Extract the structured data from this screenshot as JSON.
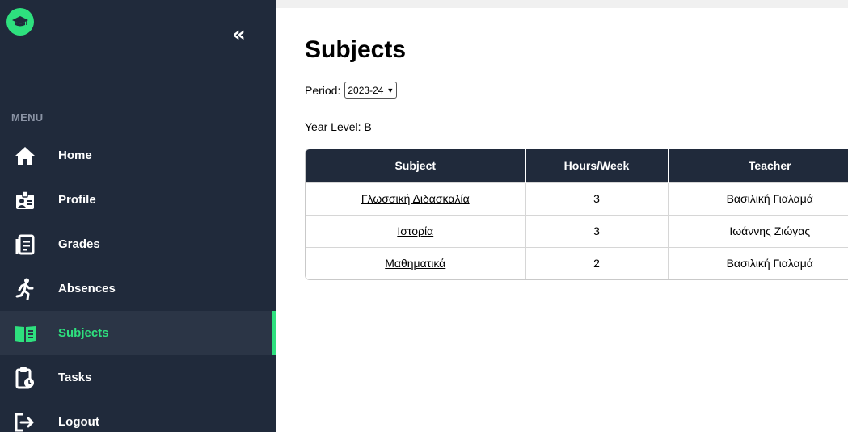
{
  "sidebar": {
    "menu_label": "MENU",
    "items": [
      {
        "label": "Home",
        "icon": "home-icon"
      },
      {
        "label": "Profile",
        "icon": "id-badge-icon"
      },
      {
        "label": "Grades",
        "icon": "document-list-icon"
      },
      {
        "label": "Absences",
        "icon": "running-person-icon"
      },
      {
        "label": "Subjects",
        "icon": "open-book-icon",
        "active": true
      },
      {
        "label": "Tasks",
        "icon": "clipboard-clock-icon"
      },
      {
        "label": "Logout",
        "icon": "logout-icon"
      }
    ]
  },
  "colors": {
    "sidebar_bg": "#202a3b",
    "accent": "#2ee07e",
    "active_bg": "#2b3546"
  },
  "main": {
    "title": "Subjects",
    "period_label": "Period:",
    "period_value": "2023-24",
    "year_level": "Year Level: B"
  },
  "table": {
    "headers": [
      "Subject",
      "Hours/Week",
      "Teacher"
    ],
    "rows": [
      {
        "subject": "Γλωσσική Διδασκαλία",
        "hours": "3",
        "teacher": "Βασιλική Γιαλαμά"
      },
      {
        "subject": "Ιστορία",
        "hours": "3",
        "teacher": "Ιωάννης Ζιώγας"
      },
      {
        "subject": "Μαθηματικά",
        "hours": "2",
        "teacher": "Βασιλική Γιαλαμά"
      }
    ]
  }
}
